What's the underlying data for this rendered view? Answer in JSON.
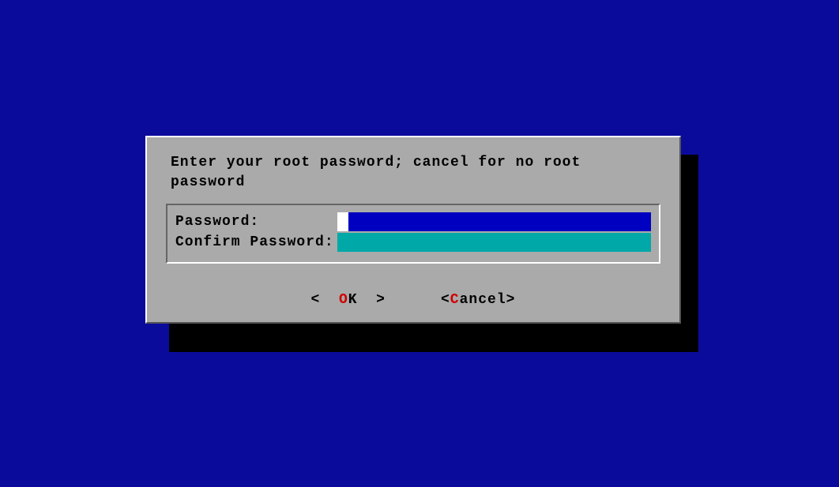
{
  "dialog": {
    "prompt": "Enter your root password; cancel for no root password",
    "fields": {
      "password": {
        "label": "Password:",
        "value": ""
      },
      "confirm": {
        "label": "Confirm Password:",
        "value": ""
      }
    },
    "buttons": {
      "ok": {
        "open": "<  ",
        "hotkey_pre": "",
        "hotkey": "O",
        "rest": "K",
        "close": "  >"
      },
      "cancel": {
        "open": "<",
        "hotkey_pre": "",
        "hotkey": "C",
        "rest": "ancel",
        "close": ">"
      }
    }
  }
}
